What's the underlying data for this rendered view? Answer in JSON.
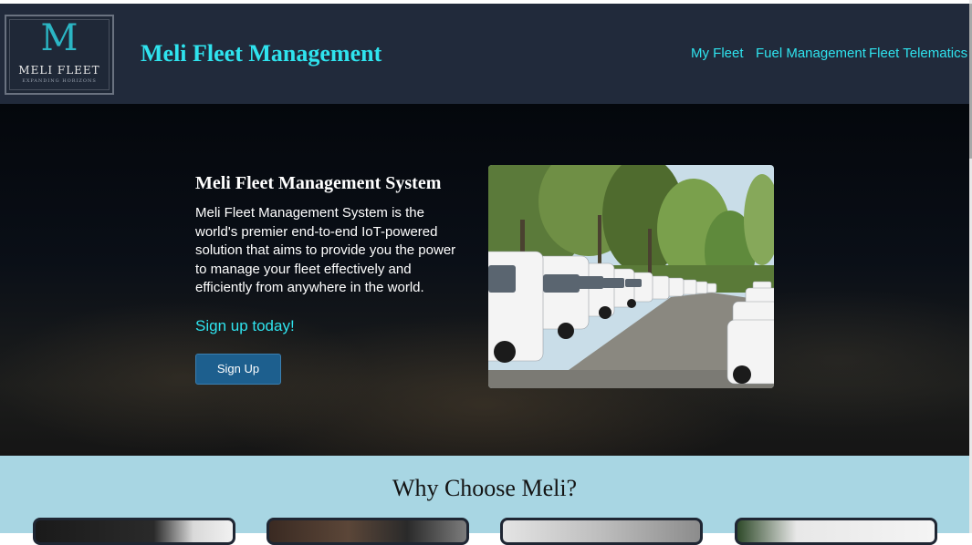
{
  "header": {
    "logo": {
      "monogram": "M",
      "name": "MELI FLEET",
      "tagline": "EXPANDING HORIZONS"
    },
    "brand_title": "Meli Fleet Management",
    "nav": [
      {
        "label": "My Fleet"
      },
      {
        "label": "Fuel Management"
      },
      {
        "label": "Fleet Telematics"
      }
    ]
  },
  "hero": {
    "title": "Meli Fleet Management System",
    "description": "Meli Fleet Management System is the world's premier end-to-end IoT-powered solution that aims to provide you the power to manage your fleet effectively and efficiently from anywhere in the world.",
    "cta_text": "Sign up today!",
    "signup_button": "Sign Up",
    "image": "white-vans-parked-in-row-photo"
  },
  "why": {
    "title": "Why Choose Meli?",
    "cards": [
      {
        "image": "card-image-1"
      },
      {
        "image": "card-image-2"
      },
      {
        "image": "card-image-3"
      },
      {
        "image": "card-image-4"
      }
    ]
  },
  "colors": {
    "header_bg": "#212a3b",
    "accent_cyan": "#2fe3ee",
    "button_blue": "#1d5f8e",
    "why_bg": "#a8d6e3"
  }
}
